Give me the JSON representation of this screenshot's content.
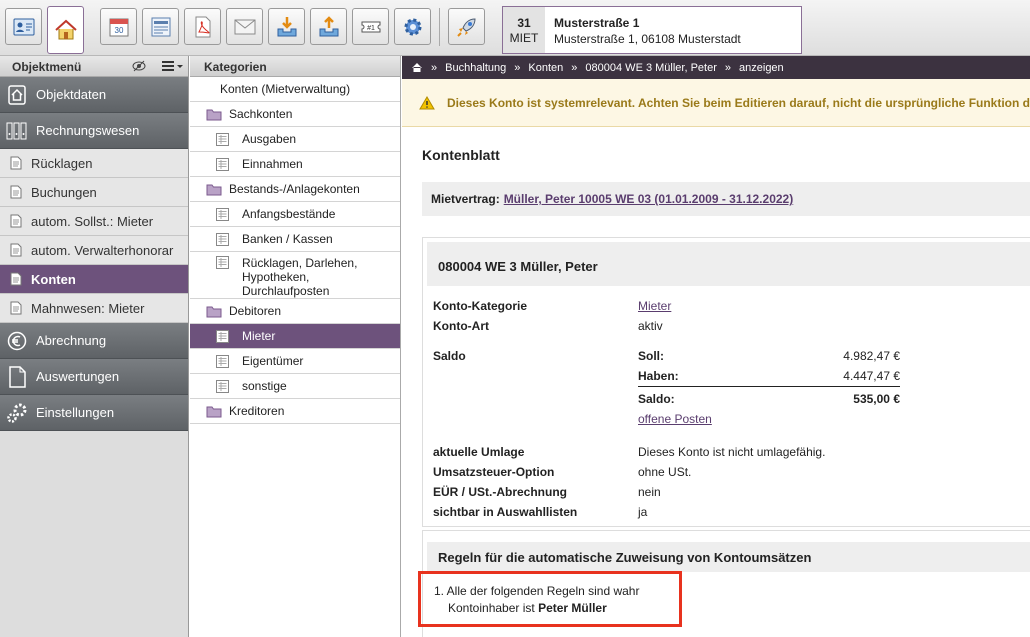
{
  "toolbar": {
    "buttons": [
      {
        "name": "contact-card-icon"
      },
      {
        "name": "home-icon",
        "active": true
      },
      {
        "name": "calendar-icon",
        "text": "30"
      },
      {
        "name": "form-icon"
      },
      {
        "name": "pdf-document-icon"
      },
      {
        "name": "mail-icon"
      },
      {
        "name": "import-tray-icon"
      },
      {
        "name": "export-tray-icon"
      },
      {
        "name": "ticket-icon",
        "text": "#1"
      },
      {
        "name": "gear-icon"
      },
      {
        "name": "rocket-icon"
      }
    ],
    "object": {
      "day": "31",
      "type": "MIET",
      "title": "Musterstraße 1",
      "address": "Musterstraße 1, 06108 Musterstadt"
    }
  },
  "left": {
    "header": "Objektmenü",
    "items": [
      {
        "label": "Objektdaten",
        "kind": "main",
        "icon": "house-icon"
      },
      {
        "label": "Rechnungswesen",
        "kind": "main",
        "icon": "binders-icon"
      },
      {
        "label": "Rücklagen",
        "kind": "sub"
      },
      {
        "label": "Buchungen",
        "kind": "sub"
      },
      {
        "label": "autom. Sollst.: Mieter",
        "kind": "sub"
      },
      {
        "label": "autom. Verwalterhonorar",
        "kind": "sub"
      },
      {
        "label": "Konten",
        "kind": "sub",
        "active": true
      },
      {
        "label": "Mahnwesen: Mieter",
        "kind": "sub"
      },
      {
        "label": "Abrechnung",
        "kind": "main",
        "icon": "euro-icon"
      },
      {
        "label": "Auswertungen",
        "kind": "main",
        "icon": "document-icon"
      },
      {
        "label": "Einstellungen",
        "kind": "main",
        "icon": "gears-icon"
      }
    ]
  },
  "categories": {
    "header": "Kategorien",
    "items": [
      {
        "label": "Konten (Mietverwaltung)",
        "level": 0,
        "icon": "none"
      },
      {
        "label": "Sachkonten",
        "level": 1,
        "icon": "folder-icon"
      },
      {
        "label": "Ausgaben",
        "level": 2,
        "icon": "ledger-icon"
      },
      {
        "label": "Einnahmen",
        "level": 2,
        "icon": "ledger-icon"
      },
      {
        "label": "Bestands-/Anlagekonten",
        "level": 1,
        "icon": "folder-icon"
      },
      {
        "label": "Anfangsbestände",
        "level": 2,
        "icon": "ledger-icon"
      },
      {
        "label": "Banken / Kassen",
        "level": 2,
        "icon": "ledger-icon"
      },
      {
        "label": "Rücklagen, Darlehen, Hypotheken, Durchlaufposten",
        "level": 2,
        "icon": "ledger-icon"
      },
      {
        "label": "Debitoren",
        "level": 1,
        "icon": "folder-icon"
      },
      {
        "label": "Mieter",
        "level": 2,
        "icon": "ledger-icon",
        "active": true
      },
      {
        "label": "Eigentümer",
        "level": 2,
        "icon": "ledger-icon"
      },
      {
        "label": "sonstige",
        "level": 2,
        "icon": "ledger-icon"
      },
      {
        "label": "Kreditoren",
        "level": 1,
        "icon": "folder-icon"
      }
    ]
  },
  "breadcrumb": [
    "Buchhaltung",
    "Konten",
    "080004 WE 3 Müller, Peter",
    "anzeigen"
  ],
  "warning": "Dieses Konto ist systemrelevant. Achten Sie beim Editieren darauf, nicht die ursprüngliche Funktion des",
  "page": {
    "title": "Kontenblatt",
    "contract_label": "Mietvertrag:",
    "contract_link": "Müller, Peter 10005 WE 03 (01.01.2009 - 31.12.2022)"
  },
  "account": {
    "heading": "080004 WE 3 Müller, Peter",
    "category_label": "Konto-Kategorie",
    "category_value": "Mieter",
    "type_label": "Konto-Art",
    "type_value": "aktiv",
    "saldo_label": "Saldo",
    "soll_label": "Soll:",
    "soll_value": "4.982,47 €",
    "haben_label": "Haben:",
    "haben_value": "4.447,47 €",
    "saldo_sum_label": "Saldo:",
    "saldo_sum_value": "535,00 €",
    "open_items_link": "offene Posten",
    "umlage_label": "aktuelle Umlage",
    "umlage_value": "Dieses Konto ist nicht umlagefähig.",
    "ust_label": "Umsatzsteuer-Option",
    "ust_value": "ohne USt.",
    "eur_label": "EÜR / USt.-Abrechnung",
    "eur_value": "nein",
    "visible_label": "sichtbar in Auswahllisten",
    "visible_value": "ja"
  },
  "rules": {
    "heading": "Regeln für die automatische Zuweisung von Kontoumsätzen",
    "rule_line": "1. Alle der folgenden Regeln sind wahr",
    "condition_prefix": "Kontoinhaber ist",
    "condition_value": "Peter Müller"
  },
  "colors": {
    "accent": "#6d527c",
    "breadcrumb_bg": "#3c3240",
    "highlight": "#e8321e",
    "warning_text": "#9a7a1a"
  }
}
